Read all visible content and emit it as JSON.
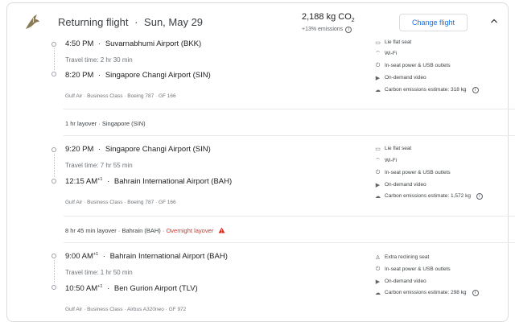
{
  "header": {
    "title": "Returning flight",
    "separator": "·",
    "date": "Sun, May 29",
    "co2_value": "2,188 kg CO",
    "co2_sub": "2",
    "emissions_note": "+13% emissions",
    "change_flight_label": "Change flight"
  },
  "segments": [
    {
      "depart_time": "4:50 PM",
      "depart_time_sup": "",
      "depart_airport": "Suvarnabhumi Airport (BKK)",
      "travel_time": "Travel time: 2 hr 30 min",
      "arrive_time": "8:20 PM",
      "arrive_time_sup": "",
      "arrive_airport": "Singapore Changi Airport (SIN)",
      "meta": "Gulf Air · Business Class · Boeing 787 · GF 166",
      "amenities": [
        "Lie flat seat",
        "Wi-Fi",
        "In-seat power & USB outlets",
        "On-demand video"
      ],
      "carbon": "Carbon emissions estimate: 318 kg"
    },
    {
      "depart_time": "9:20 PM",
      "depart_time_sup": "",
      "depart_airport": "Singapore Changi Airport (SIN)",
      "travel_time": "Travel time: 7 hr 55 min",
      "arrive_time": "12:15 AM",
      "arrive_time_sup": "+1",
      "arrive_airport": "Bahrain International Airport (BAH)",
      "meta": "Gulf Air · Business Class · Boeing 787 · GF 166",
      "amenities": [
        "Lie flat seat",
        "Wi-Fi",
        "In-seat power & USB outlets",
        "On-demand video"
      ],
      "carbon": "Carbon emissions estimate: 1,572 kg"
    },
    {
      "depart_time": "9:00 AM",
      "depart_time_sup": "+1",
      "depart_airport": "Bahrain International Airport (BAH)",
      "travel_time": "Travel time: 1 hr 50 min",
      "arrive_time": "10:50 AM",
      "arrive_time_sup": "+1",
      "arrive_airport": "Ben Gurion Airport (TLV)",
      "meta": "Gulf Air · Business Class · Airbus A320neo · GF 972",
      "amenities": [
        "Extra reclining seat",
        "In-seat power & USB outlets",
        "On-demand video"
      ],
      "carbon": "Carbon emissions estimate: 298 kg"
    }
  ],
  "layovers": [
    {
      "text": "1 hr layover · Singapore (SIN)",
      "overnight": ""
    },
    {
      "text": "8 hr 45 min layover · Bahrain (BAH) · ",
      "overnight": "Overnight layover"
    }
  ],
  "icons": {
    "airline_logo": "gulf-air-falcon-icon",
    "collapse": "chevron-up-icon",
    "seat": "seat-icon",
    "wifi": "wifi-icon",
    "power": "power-plug-icon",
    "video": "video-icon",
    "co2": "co2-icon",
    "info": "info-icon",
    "warning": "warning-icon"
  },
  "colors": {
    "accent": "#1a73e8",
    "warning": "#d93025",
    "border": "#dadce0"
  }
}
